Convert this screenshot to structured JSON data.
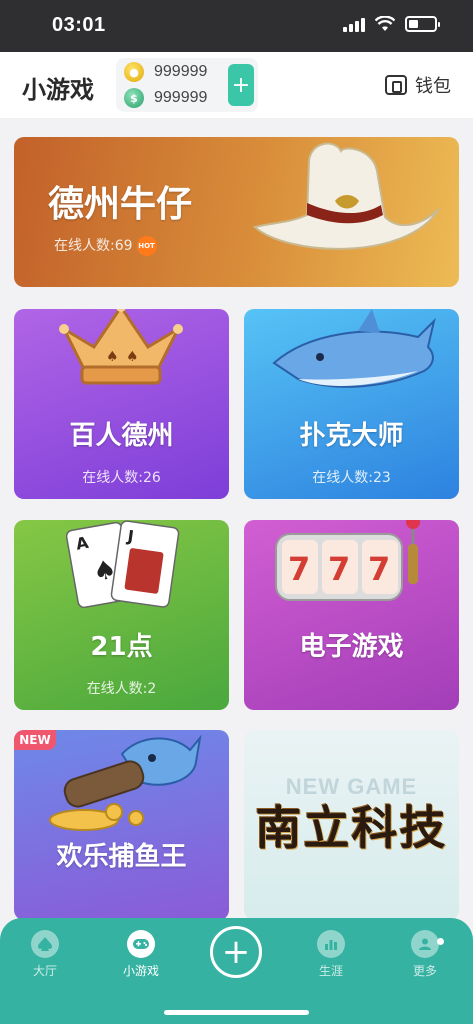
{
  "status_bar": {
    "time": "03:01"
  },
  "header": {
    "title": "小游戏",
    "gold_balance": "999999",
    "cash_balance": "999999",
    "add_label": "+",
    "wallet_label": "钱包"
  },
  "games": [
    {
      "title": "德州牛仔",
      "online": "在线人数:69",
      "hot": "HOT"
    },
    {
      "title": "百人德州",
      "online": "在线人数:26"
    },
    {
      "title": "扑克大师",
      "online": "在线人数:23"
    },
    {
      "title": "21点",
      "online": "在线人数:2"
    },
    {
      "title": "电子游戏"
    },
    {
      "title": "欢乐捕鱼王",
      "badge": "NEW"
    },
    {
      "title": "NEW GAME",
      "brand": "南立科技"
    }
  ],
  "nav": {
    "items": [
      {
        "label": "大厅",
        "icon": "spade-icon"
      },
      {
        "label": "小游戏",
        "icon": "gamepad-icon"
      },
      {
        "label": "生涯",
        "icon": "chart-icon"
      },
      {
        "label": "更多",
        "icon": "profile-icon"
      }
    ],
    "add_label": "+"
  },
  "colors": {
    "accent": "#36b2a2"
  }
}
